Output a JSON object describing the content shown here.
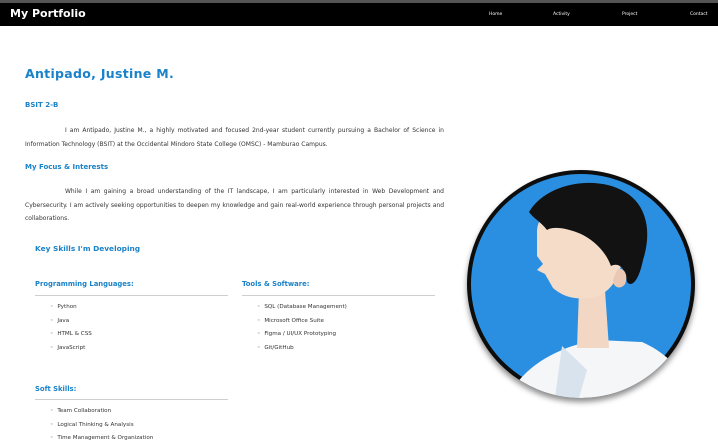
{
  "header": {
    "brand": "My Portfolio",
    "nav": [
      {
        "label": "Home"
      },
      {
        "label": "Activity"
      },
      {
        "label": "Project"
      },
      {
        "label": "Contact"
      }
    ]
  },
  "profile": {
    "name": "Antipado, Justine M.",
    "section_label": "BSIT 2-B",
    "intro": "I am Antipado, Justine M., a highly motivated and focused 2nd-year student currently pursuing a Bachelor of Science in Information Technology (BSIT) at the Occidental Mindoro State College (OMSC) - Mamburao Campus.",
    "focus_heading": "My Focus & Interests",
    "focus_text": "While I am gaining a broad understanding of the IT landscape, I am particularly interested in Web Development and Cybersecurity. I am actively seeking opportunities to deepen my knowledge and gain real-world experience through personal projects and collaborations."
  },
  "skills": {
    "heading": "Key Skills I'm Developing",
    "programming": {
      "heading": "Programming Languages:",
      "items": [
        "Python",
        "Java",
        "HTML & CSS",
        "JavaScript"
      ]
    },
    "tools": {
      "heading": "Tools & Software:",
      "items": [
        "SQL (Database Management)",
        "Microsoft Office Suite",
        "Figma / UI/UX Prototyping",
        "Git/GitHub"
      ]
    },
    "soft": {
      "heading": "Soft Skills:",
      "items": [
        "Team Collaboration",
        "Logical Thinking & Analysis",
        "Time Management & Organization"
      ]
    }
  },
  "colors": {
    "accent": "#1a82c8",
    "header_bg": "#000000",
    "avatar_bg": "#2a8fe0"
  }
}
